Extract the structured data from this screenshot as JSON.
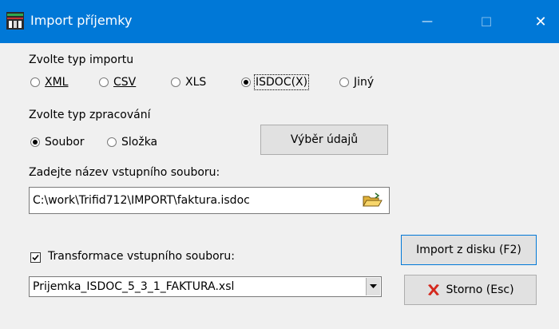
{
  "window": {
    "title": "Import příjemky",
    "minimize_glyph": "—",
    "maximize_glyph": "☐",
    "close_glyph": "✕"
  },
  "import_type": {
    "label": "Zvolte typ importu",
    "options": [
      "XML",
      "CSV",
      "XLS",
      "ISDOC(X)",
      "Jiný"
    ],
    "selected": "ISDOC(X)"
  },
  "processing_type": {
    "label": "Zvolte typ zpracování",
    "options": [
      "Soubor",
      "Složka"
    ],
    "selected": "Soubor"
  },
  "select_data_button": "Výběr údajů",
  "input_file": {
    "label": "Zadejte název vstupního souboru:",
    "value": "C:\\work\\Trifid712\\IMPORT\\faktura.isdoc"
  },
  "transform": {
    "label": "Transformace vstupního souboru:",
    "checked": true,
    "selected": "Prijemka_ISDOC_5_3_1_FAKTURA.xsl"
  },
  "import_button": "Import z disku (F2)",
  "cancel_button": "Storno (Esc)",
  "icons": {
    "app": "app-icon",
    "folder": "open-folder-icon",
    "cancel": "red-x-icon",
    "dropdown": "chevron-down-icon"
  },
  "colors": {
    "titlebar": "#0078d7",
    "background": "#f0f0f0",
    "cancel_icon": "#d4281d",
    "folder": "#f2c94c"
  }
}
